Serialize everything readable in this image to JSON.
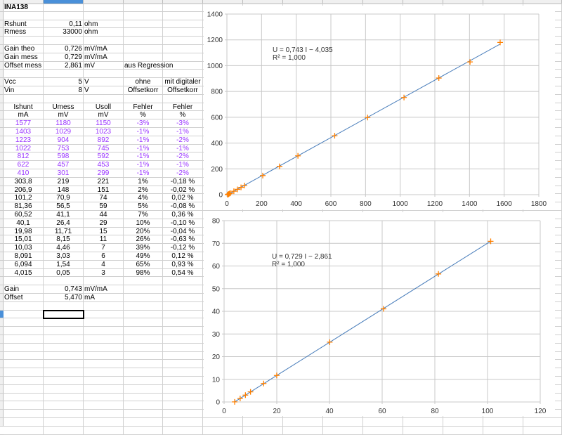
{
  "sheet": {
    "rows": [
      [
        {
          "t": "INA138",
          "a": "l",
          "b": true
        }
      ],
      [],
      [
        {
          "t": "Rshunt",
          "a": "l"
        },
        {
          "t": "0,11",
          "a": "r"
        },
        {
          "t": "ohm",
          "a": "l"
        }
      ],
      [
        {
          "t": "Rmess",
          "a": "l"
        },
        {
          "t": "33000",
          "a": "r"
        },
        {
          "t": "ohm",
          "a": "l"
        }
      ],
      [],
      [
        {
          "t": "Gain theo",
          "a": "l"
        },
        {
          "t": "0,726",
          "a": "r"
        },
        {
          "t": "mV/mA",
          "a": "l"
        }
      ],
      [
        {
          "t": "Gain mess",
          "a": "l"
        },
        {
          "t": "0,729",
          "a": "r"
        },
        {
          "t": "mV/mA",
          "a": "l"
        }
      ],
      [
        {
          "t": "Offset mess",
          "a": "l"
        },
        {
          "t": "2,861",
          "a": "r"
        },
        {
          "t": "mV",
          "a": "l"
        },
        {
          "t": "aus Regression",
          "a": "l"
        }
      ],
      [],
      [
        {
          "t": "Vcc",
          "a": "l"
        },
        {
          "t": "5",
          "a": "r"
        },
        {
          "t": "V",
          "a": "l"
        },
        {
          "t": "ohne",
          "a": "c"
        },
        {
          "t": "mit digitaler",
          "a": "c"
        }
      ],
      [
        {
          "t": "Vin",
          "a": "l"
        },
        {
          "t": "8",
          "a": "r"
        },
        {
          "t": "V",
          "a": "l"
        },
        {
          "t": "Offsetkorr",
          "a": "c"
        },
        {
          "t": "Offsetkorr",
          "a": "c"
        }
      ],
      [],
      [
        {
          "t": "Ishunt",
          "a": "c"
        },
        {
          "t": "Umess",
          "a": "c"
        },
        {
          "t": "Usoll",
          "a": "c"
        },
        {
          "t": "Fehler",
          "a": "c"
        },
        {
          "t": "Fehler",
          "a": "c"
        }
      ],
      [
        {
          "t": "mA",
          "a": "c"
        },
        {
          "t": "mV",
          "a": "c"
        },
        {
          "t": "mV",
          "a": "c"
        },
        {
          "t": "%",
          "a": "c"
        },
        {
          "t": "%",
          "a": "c"
        }
      ]
    ],
    "data_rows_purple": [
      [
        "1577",
        "1180",
        "1150",
        "-3%",
        "-3%"
      ],
      [
        "1403",
        "1029",
        "1023",
        "-1%",
        "-1%"
      ],
      [
        "1223",
        "904",
        "892",
        "-1%",
        "-2%"
      ],
      [
        "1022",
        "753",
        "745",
        "-1%",
        "-1%"
      ],
      [
        "812",
        "598",
        "592",
        "-1%",
        "-2%"
      ],
      [
        "622",
        "457",
        "453",
        "-1%",
        "-1%"
      ],
      [
        "410",
        "301",
        "299",
        "-1%",
        "-2%"
      ]
    ],
    "data_rows": [
      [
        "303,8",
        "219",
        "221",
        "1%",
        "-0,18 %"
      ],
      [
        "206,9",
        "148",
        "151",
        "2%",
        "-0,02 %"
      ],
      [
        "101,2",
        "70,9",
        "74",
        "4%",
        "0,02 %"
      ],
      [
        "81,36",
        "56,5",
        "59",
        "5%",
        "-0,08 %"
      ],
      [
        "60,52",
        "41,1",
        "44",
        "7%",
        "0,36 %"
      ],
      [
        "40,1",
        "26,4",
        "29",
        "10%",
        "-0,10 %"
      ],
      [
        "19,98",
        "11,71",
        "15",
        "20%",
        "-0,04 %"
      ],
      [
        "15,01",
        "8,15",
        "11",
        "26%",
        "-0,63 %"
      ],
      [
        "10,03",
        "4,46",
        "7",
        "39%",
        "-0,12 %"
      ],
      [
        "8,091",
        "3,03",
        "6",
        "49%",
        "0,12 %"
      ],
      [
        "6,094",
        "1,54",
        "4",
        "65%",
        "0,93 %"
      ],
      [
        "4,015",
        "0,05",
        "3",
        "98%",
        "0,54 %"
      ]
    ],
    "footer_rows": [
      [],
      [
        {
          "t": "Gain",
          "a": "l"
        },
        {
          "t": "0,743",
          "a": "r"
        },
        {
          "t": "mV/mA",
          "a": "l"
        }
      ],
      [
        {
          "t": "Offset",
          "a": "l"
        },
        {
          "t": "5,470",
          "a": "r"
        },
        {
          "t": "mA",
          "a": "l"
        }
      ]
    ]
  },
  "colors": {
    "purple": "#9933ff",
    "marker": "#ff8000",
    "trend": "#4a7ebb",
    "grid": "#c8c8c8"
  },
  "chart_data": [
    {
      "type": "scatter",
      "title": "",
      "equation": "U = 0,743 I − 4,035",
      "r2": "R² = 1,000",
      "xlim": [
        0,
        1800
      ],
      "ylim": [
        0,
        1400
      ],
      "xstep": 200,
      "ystep": 200,
      "xticks": [
        "0",
        "200",
        "400",
        "600",
        "800",
        "1000",
        "1200",
        "1400",
        "1600",
        "1800"
      ],
      "yticks": [
        "0",
        "200",
        "400",
        "600",
        "800",
        "1000",
        "1200",
        "1400"
      ],
      "x": [
        1577,
        1403,
        1223,
        1022,
        812,
        622,
        410,
        303.8,
        206.9,
        101.2,
        81.36,
        60.52,
        40.1,
        19.98,
        15.01,
        10.03,
        8.091,
        6.094,
        4.015
      ],
      "y": [
        1180,
        1029,
        904,
        753,
        598,
        457,
        301,
        219,
        148,
        70.9,
        56.5,
        41.1,
        26.4,
        11.71,
        8.15,
        4.46,
        3.03,
        1.54,
        0.05
      ],
      "trend": {
        "slope": 0.743,
        "intercept": -4.035
      },
      "grid": true
    },
    {
      "type": "scatter",
      "title": "",
      "equation": "U = 0,729 I − 2,861",
      "r2": "R² = 1,000",
      "xlim": [
        0,
        120
      ],
      "ylim": [
        0,
        80
      ],
      "xstep": 20,
      "ystep": 10,
      "xticks": [
        "0",
        "20",
        "40",
        "60",
        "80",
        "100",
        "120"
      ],
      "yticks": [
        "0",
        "10",
        "20",
        "30",
        "40",
        "50",
        "60",
        "70",
        "80"
      ],
      "x": [
        101.2,
        81.36,
        60.52,
        40.1,
        19.98,
        15.01,
        10.03,
        8.091,
        6.094,
        4.015
      ],
      "y": [
        70.9,
        56.5,
        41.1,
        26.4,
        11.71,
        8.15,
        4.46,
        3.03,
        1.54,
        0.05
      ],
      "trend": {
        "slope": 0.729,
        "intercept": -2.861
      },
      "grid": true
    }
  ]
}
